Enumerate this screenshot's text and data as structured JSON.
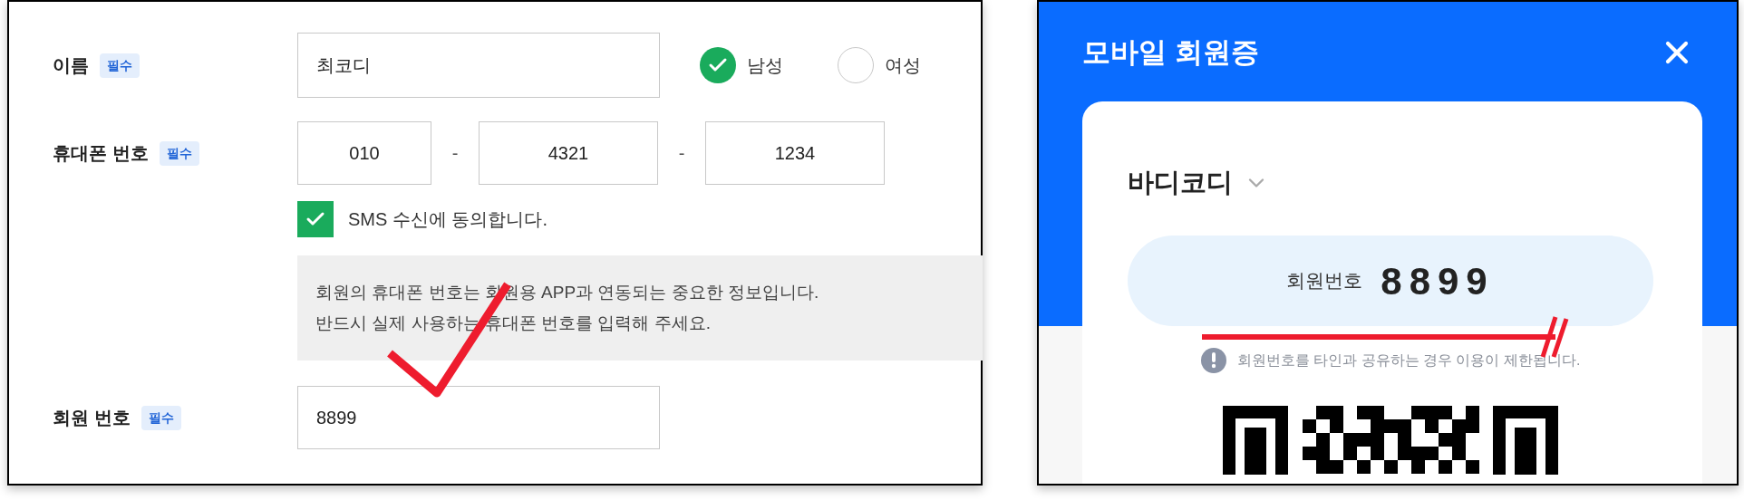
{
  "form": {
    "name_field": {
      "label": "이름",
      "badge": "필수",
      "value": "최코디"
    },
    "gender": [
      {
        "label": "남성",
        "selected": true
      },
      {
        "label": "여성",
        "selected": false
      }
    ],
    "phone_field": {
      "label": "휴대폰 번호",
      "badge": "필수",
      "parts": [
        "010",
        "4321",
        "1234"
      ],
      "separator": "-"
    },
    "sms_consent": {
      "label": "SMS 수신에 동의합니다.",
      "checked": true
    },
    "notice": [
      "회원의 휴대폰 번호는 회원용 APP과 연동되는 중요한 정보입니다.",
      "반드시 실제 사용하는 휴대폰 번호를 입력해 주세요."
    ],
    "member_field": {
      "label": "회원 번호",
      "badge": "필수",
      "value": "8899"
    }
  },
  "mobile_card": {
    "title": "모바일 회원증",
    "member_name": "바디코디",
    "number_label": "회원번호",
    "number": "8899",
    "warning": "회원번호를 타인과 공유하는 경우 이용이 제한됩니다."
  }
}
